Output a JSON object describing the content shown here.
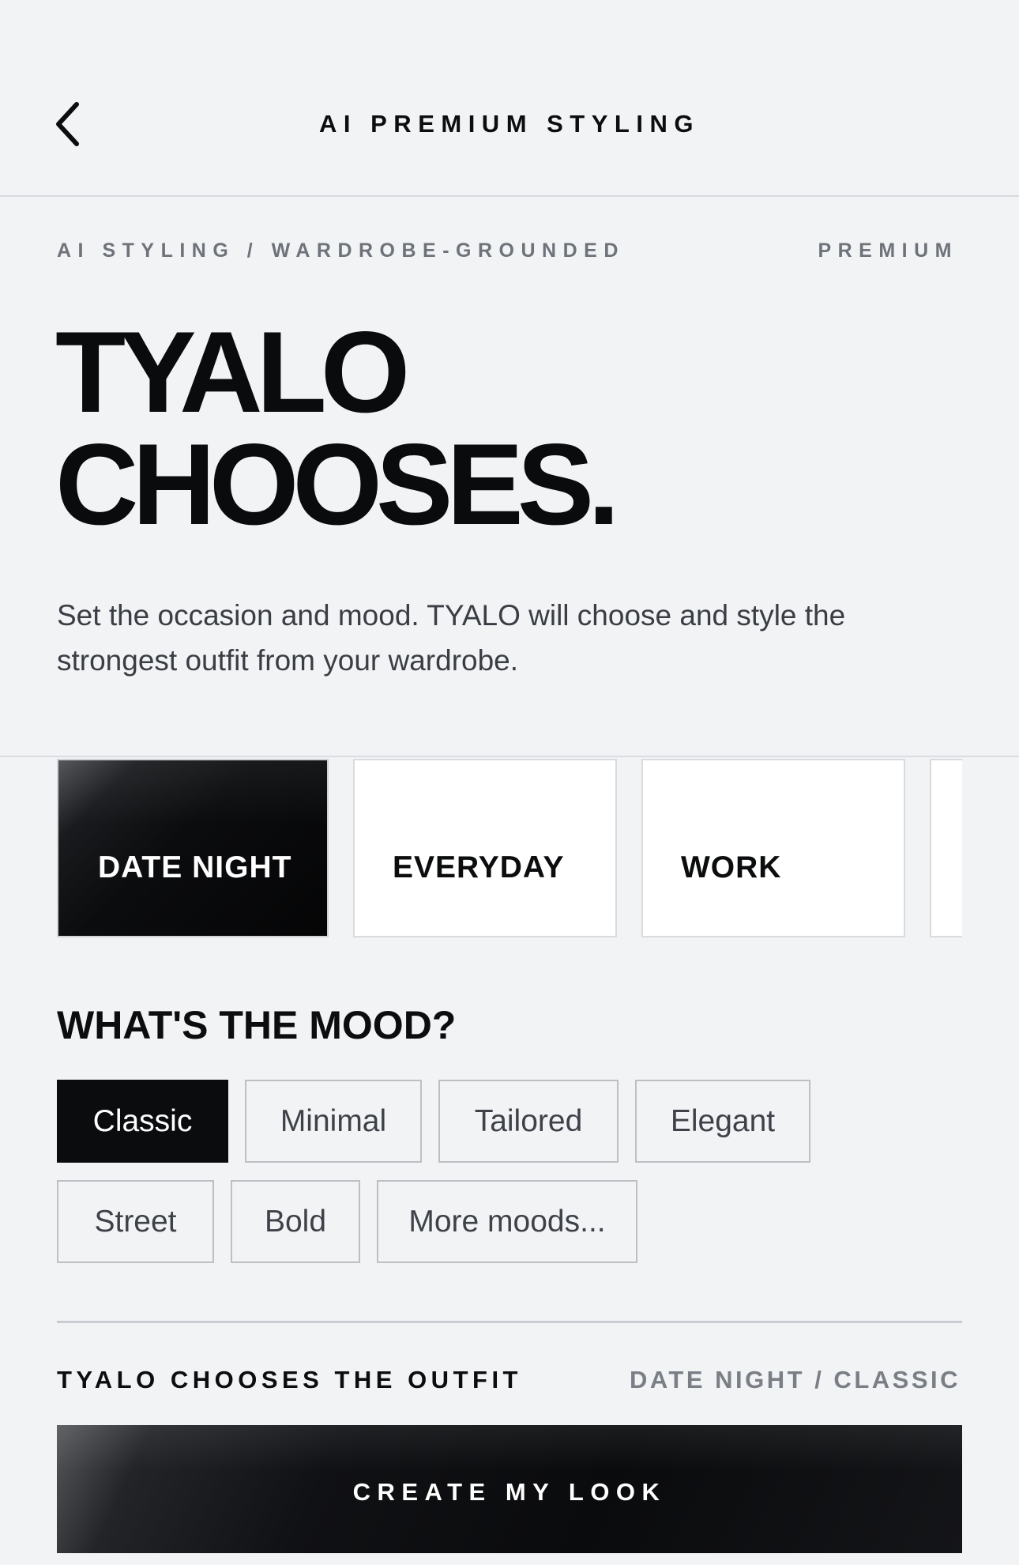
{
  "header": {
    "title": "AI PREMIUM STYLING",
    "back_icon": "chevron-left-icon"
  },
  "eyebrow": {
    "left": "AI STYLING / WARDROBE-GROUNDED",
    "right": "PREMIUM"
  },
  "hero": {
    "title_line1": "TYALO",
    "title_line2": "CHOOSES.",
    "description": "Set the occasion and mood. TYALO will choose and style the strongest outfit from your wardrobe."
  },
  "occasions": [
    {
      "label": "DATE NIGHT",
      "selected": true
    },
    {
      "label": "EVERYDAY",
      "selected": false
    },
    {
      "label": "WORK",
      "selected": false
    },
    {
      "label": "",
      "selected": false
    }
  ],
  "mood": {
    "title": "WHAT'S THE MOOD?",
    "options": [
      "Classic",
      "Minimal",
      "Tailored",
      "Elegant",
      "Street",
      "Bold",
      "More moods..."
    ],
    "selected": "Classic"
  },
  "summary": {
    "label": "TYALO CHOOSES THE OUTFIT",
    "selection": "DATE NIGHT / CLASSIC"
  },
  "cta": {
    "label": "CREATE MY LOOK"
  },
  "colors": {
    "background": "#f1f3f5",
    "primary": "#0b0c0e",
    "muted_text": "#6e737a",
    "border": "#bcc0c5"
  }
}
